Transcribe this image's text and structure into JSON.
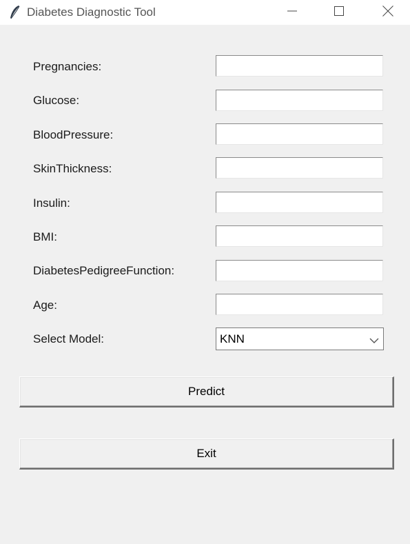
{
  "window": {
    "title": "Diabetes Diagnostic Tool",
    "icon": "feather-icon",
    "controls": [
      "minimize-icon",
      "maximize-icon",
      "close-icon"
    ]
  },
  "form": {
    "fields": [
      {
        "label": "Pregnancies:",
        "value": ""
      },
      {
        "label": "Glucose:",
        "value": ""
      },
      {
        "label": "BloodPressure:",
        "value": ""
      },
      {
        "label": "SkinThickness:",
        "value": ""
      },
      {
        "label": "Insulin:",
        "value": ""
      },
      {
        "label": "BMI:",
        "value": ""
      },
      {
        "label": "DiabetesPedigreeFunction:",
        "value": ""
      },
      {
        "label": "Age:",
        "value": ""
      }
    ],
    "model": {
      "label": "Select Model:",
      "selected": "KNN"
    }
  },
  "buttons": {
    "predict": "Predict",
    "exit": "Exit"
  }
}
